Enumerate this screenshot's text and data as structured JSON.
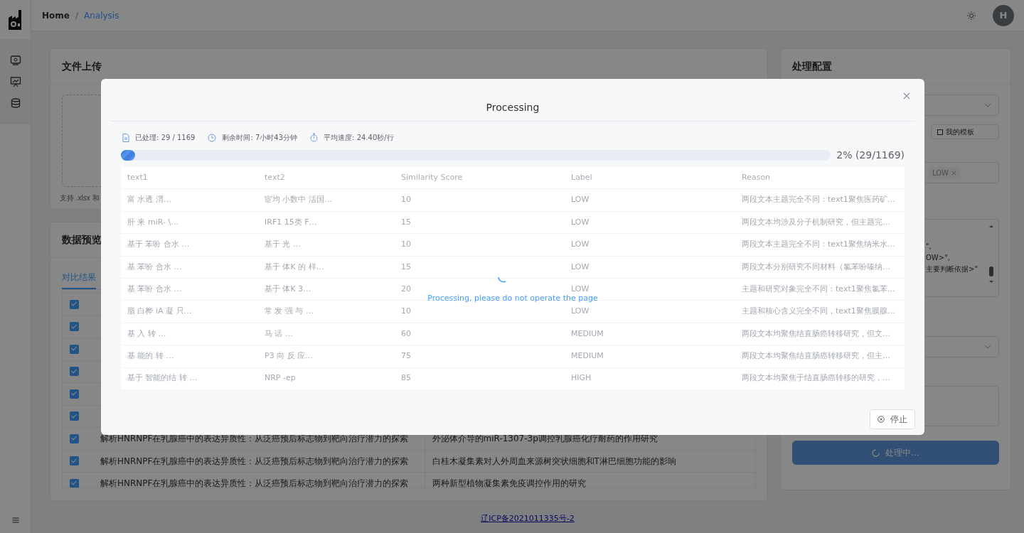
{
  "breadcrumb": {
    "separator": "/",
    "items": [
      {
        "label": "Home",
        "current": false
      },
      {
        "label": "Analysis",
        "current": true
      }
    ]
  },
  "user": {
    "avatar_initial": "H"
  },
  "upload_card": {
    "title": "文件上传",
    "hint": "支持 .xlsx 和"
  },
  "preview_card": {
    "title": "数据预览",
    "tabs": [
      {
        "label": "对比结果",
        "selected": true
      }
    ],
    "rows": [
      {
        "checked": true
      },
      {
        "checked": true
      },
      {
        "checked": true
      },
      {
        "checked": true
      },
      {
        "checked": true
      },
      {
        "checked": true
      },
      {
        "checked": true,
        "text1": "解析HNRNPF在乳腺癌中的表达异质性：从泛癌预后标志物到靶向治疗潜力的探索",
        "text2": "外泌体介导的miR-1307-3p调控乳腺癌化疗耐药的作用研究"
      },
      {
        "checked": true,
        "text1": "解析HNRNPF在乳腺癌中的表达异质性：从泛癌预后标志物到靶向治疗潜力的探索",
        "text2": "白桂木凝集素对人外周血来源树突状细胞和T淋巴细胞功能的影响"
      },
      {
        "checked": true,
        "text1": "解析HNRNPF在乳腺癌中的表达异质性：从泛癌预后标志物到靶向治疗潜力的探索",
        "text2": "两种新型植物凝集素免疫调控作用的研究"
      }
    ]
  },
  "config_card": {
    "title": "处理配置",
    "template_button": "我的模板",
    "tags": [
      "LOW"
    ],
    "prompt_lines": [
      "\",",
      "OW>\",",
      "主要判断依据>\""
    ],
    "submit_button": {
      "label": "处理中...",
      "disabled": true
    }
  },
  "footer": {
    "icp": "辽ICP备2021011335号-2"
  },
  "modal": {
    "title": "Processing",
    "stats": [
      {
        "kind": "processed",
        "text": "已处理: 29 / 1169"
      },
      {
        "kind": "remaining",
        "text": "剩余时间: 7小时43分钟"
      },
      {
        "kind": "speed",
        "text": "平均速度: 24.40秒/行"
      }
    ],
    "progress": {
      "level": 0.02,
      "reading": "2% (29/1169)"
    },
    "table": {
      "columns": [
        "text1",
        "text2",
        "Similarity Score",
        "Label",
        "Reason"
      ],
      "rows": [
        [
          "富 水透 渭…",
          "宦均 小数中 活国…",
          "10",
          "LOW",
          "两段文本主题完全不同：text1聚焦医药矿…"
        ],
        [
          "肝 来 miR- \\…",
          "IRF1 15类 F…",
          "15",
          "LOW",
          "两段文本均涉及分子机制研究，但主题完…"
        ],
        [
          "基于 苯吩 合水 …",
          "基于 光 …",
          "10",
          "LOW",
          "两段文本主题完全不同：text1聚焦纳米水…"
        ],
        [
          "基 苯吩 合水 …",
          "基于 体K 的 样…",
          "15",
          "LOW",
          "两段文本分别研究不同材料（氯苯吩嗪纳…"
        ],
        [
          "基 苯吩 合水 …",
          "基于 体K 3…",
          "20",
          "LOW",
          "主题和研究对象完全不同：text1聚焦氯苯…"
        ],
        [
          "脂 白桦 iA 凝 只…",
          "常 发 强 与 …",
          "10",
          "LOW",
          "主题和核心含义完全不同，text1聚焦膜腺…"
        ],
        [
          "基 入 转 …",
          "马 话 …",
          "60",
          "MEDIUM",
          "两段文本均聚焦结直肠癌转移研究，但文…"
        ],
        [
          "基 能的 转 …",
          "P3 向 反 应…",
          "75",
          "MEDIUM",
          "两段文本均聚焦结直肠癌转移研究，但主…"
        ],
        [
          "基于 智能的结 转 …",
          "NRP -ep",
          "85",
          "HIGH",
          "两段文本均聚焦于结直肠癌转移的研究，…"
        ]
      ]
    },
    "loading_text": "Processing, please do not operate the page",
    "stop_button": "停止"
  }
}
